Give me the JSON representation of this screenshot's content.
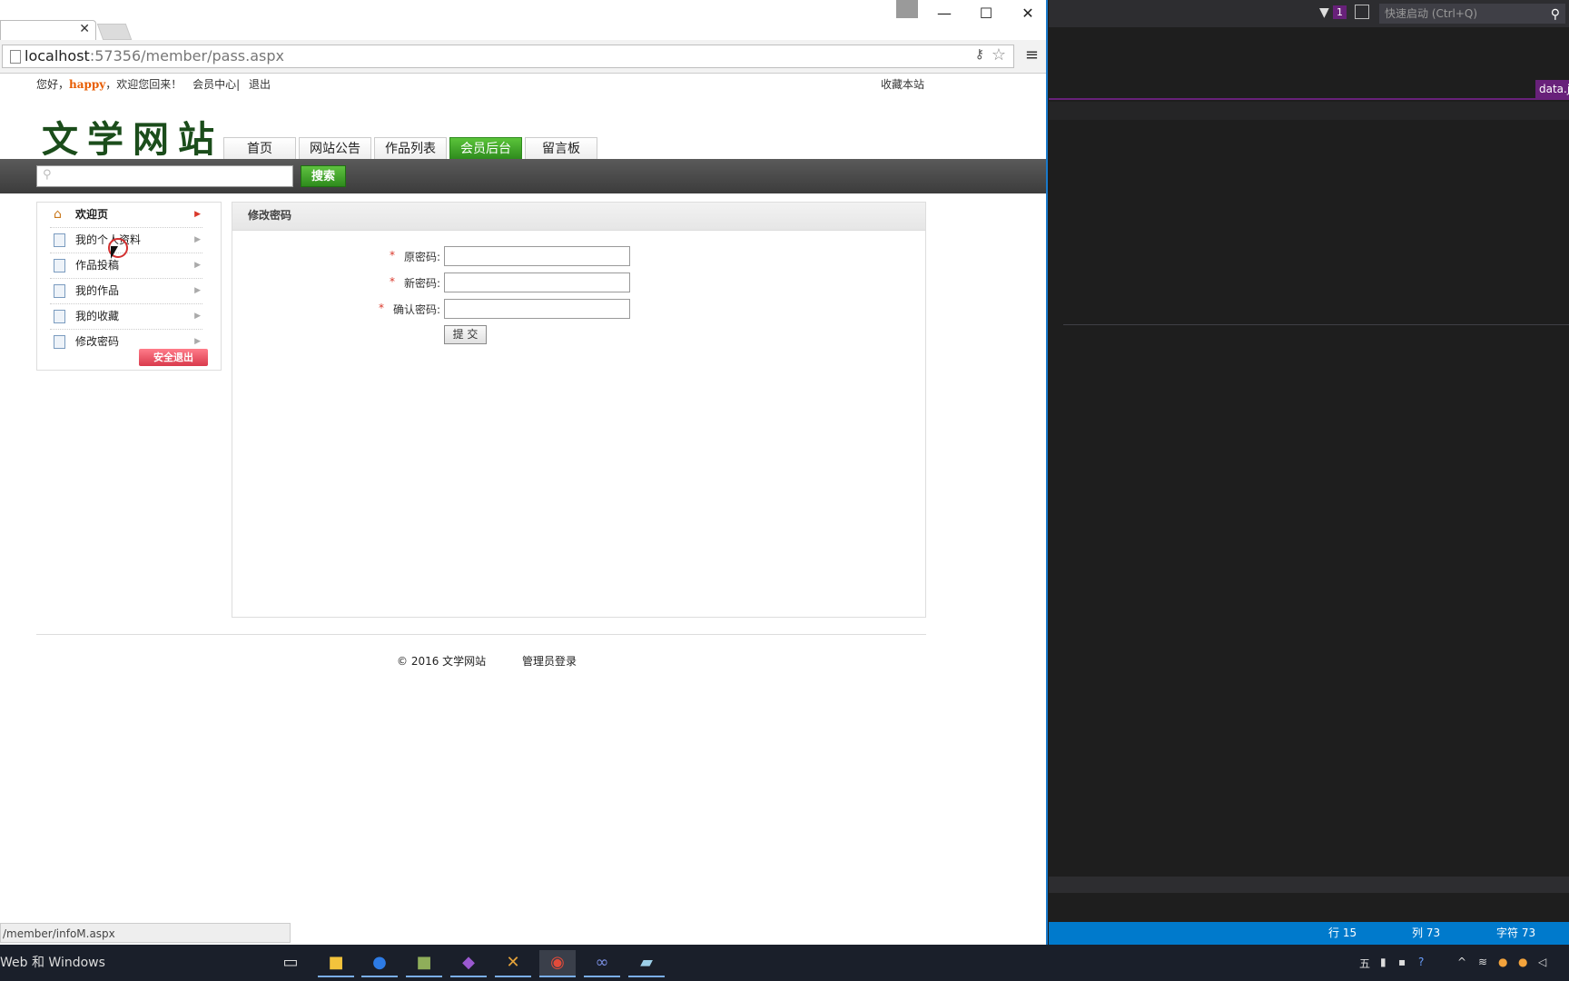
{
  "ide": {
    "filter_badge": "1",
    "quick_launch_placeholder": "快速启动 (Ctrl+Q)",
    "tab_file": "data.js",
    "status": {
      "line": "行 15",
      "col": "列 73",
      "char": "字符 73"
    },
    "colors": {
      "accent": "#68217a",
      "statusbar": "#007acc"
    }
  },
  "browser": {
    "url_host": "localhost",
    "url_rest": ":57356/member/pass.aspx",
    "status_url": "/member/infoM.aspx"
  },
  "page": {
    "topnav": {
      "greeting": "您好，",
      "username": "happy",
      "welcome": "，欢迎您回来！",
      "member_center": "会员中心",
      "sep": "|",
      "logout": "退出"
    },
    "favorite": "收藏本站",
    "logo": "文学网站",
    "nav": [
      {
        "label": "首页"
      },
      {
        "label": "网站公告"
      },
      {
        "label": "作品列表"
      },
      {
        "label": "会员后台"
      },
      {
        "label": "留言板"
      }
    ],
    "search": {
      "button": "搜索",
      "placeholder": ""
    },
    "sidebar": {
      "items": [
        {
          "label": "欢迎页"
        },
        {
          "label": "我的个人资料"
        },
        {
          "label": "作品投稿"
        },
        {
          "label": "我的作品"
        },
        {
          "label": "我的收藏"
        },
        {
          "label": "修改密码"
        }
      ],
      "logout_button": "安全退出"
    },
    "panel": {
      "title": "修改密码",
      "required_mark": "*",
      "fields": [
        {
          "label": "原密码:",
          "value": ""
        },
        {
          "label": "新密码:",
          "value": ""
        },
        {
          "label": "确认密码:",
          "value": ""
        }
      ],
      "submit": "提 交"
    },
    "footer": {
      "copyright": "© 2016  文学网站",
      "admin_login": "管理员登录"
    }
  },
  "taskbar": {
    "search_text": "Web 和 Windows",
    "apps": [
      "task-view",
      "file-explorer",
      "app-blue",
      "image-viewer",
      "visual-studio",
      "tools",
      "chrome",
      "infinity-app",
      "notepad"
    ]
  }
}
